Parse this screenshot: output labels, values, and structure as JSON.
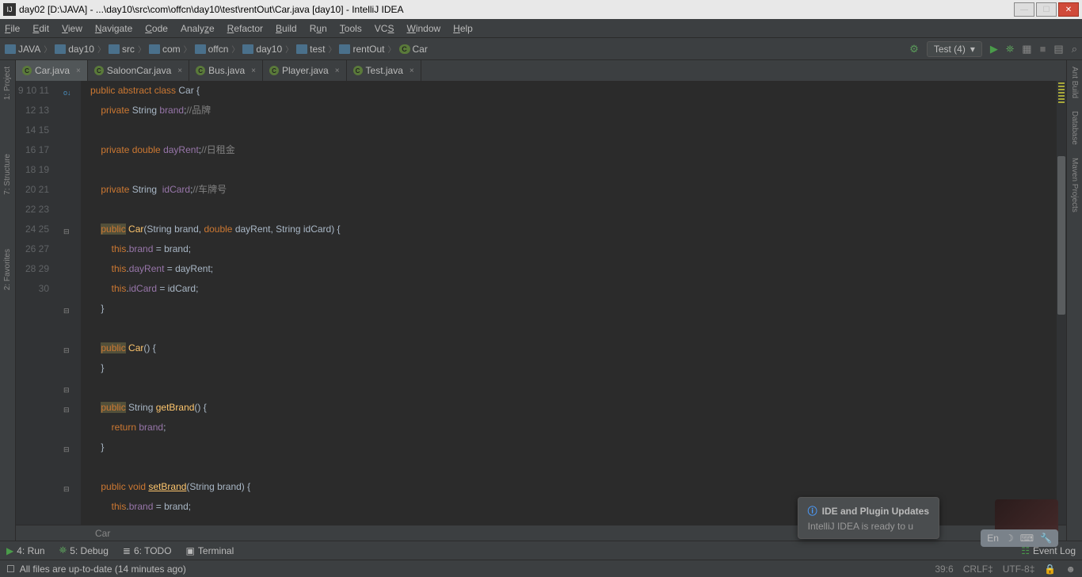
{
  "title": "day02 [D:\\JAVA] - ...\\day10\\src\\com\\offcn\\day10\\test\\rentOut\\Car.java [day10] - IntelliJ IDEA",
  "menu": {
    "file": "File",
    "edit": "Edit",
    "view": "View",
    "navigate": "Navigate",
    "code": "Code",
    "analyze": "Analyze",
    "refactor": "Refactor",
    "build": "Build",
    "run": "Run",
    "tools": "Tools",
    "vcs": "VCS",
    "window": "Window",
    "help": "Help"
  },
  "breadcrumbs": [
    "JAVA",
    "day10",
    "src",
    "com",
    "offcn",
    "day10",
    "test",
    "rentOut",
    "Car"
  ],
  "run_config": "Test (4)",
  "tabs": [
    {
      "name": "Car.java",
      "active": true
    },
    {
      "name": "SaloonCar.java",
      "active": false
    },
    {
      "name": "Bus.java",
      "active": false
    },
    {
      "name": "Player.java",
      "active": false
    },
    {
      "name": "Test.java",
      "active": false
    }
  ],
  "left_tools": [
    "1: Project",
    "7: Structure",
    "2: Favorites"
  ],
  "right_tools": [
    "Ant Build",
    "Database",
    "Maven Projects"
  ],
  "context": "Car",
  "bottom_tabs": {
    "run": "4: Run",
    "debug": "5: Debug",
    "todo": "6: TODO",
    "terminal": "Terminal",
    "event_log": "Event Log"
  },
  "notification": {
    "title": "IDE and Plugin Updates",
    "body": "IntelliJ IDEA is ready to u"
  },
  "status": {
    "msg": "All files are up-to-date (14 minutes ago)",
    "pos": "39:6",
    "eol": "CRLF",
    "enc": "UTF-8"
  },
  "ime": "En",
  "code_lines": [
    9,
    10,
    11,
    12,
    13,
    14,
    15,
    16,
    17,
    18,
    19,
    20,
    21,
    22,
    23,
    24,
    25,
    26,
    27,
    28,
    29,
    30
  ]
}
